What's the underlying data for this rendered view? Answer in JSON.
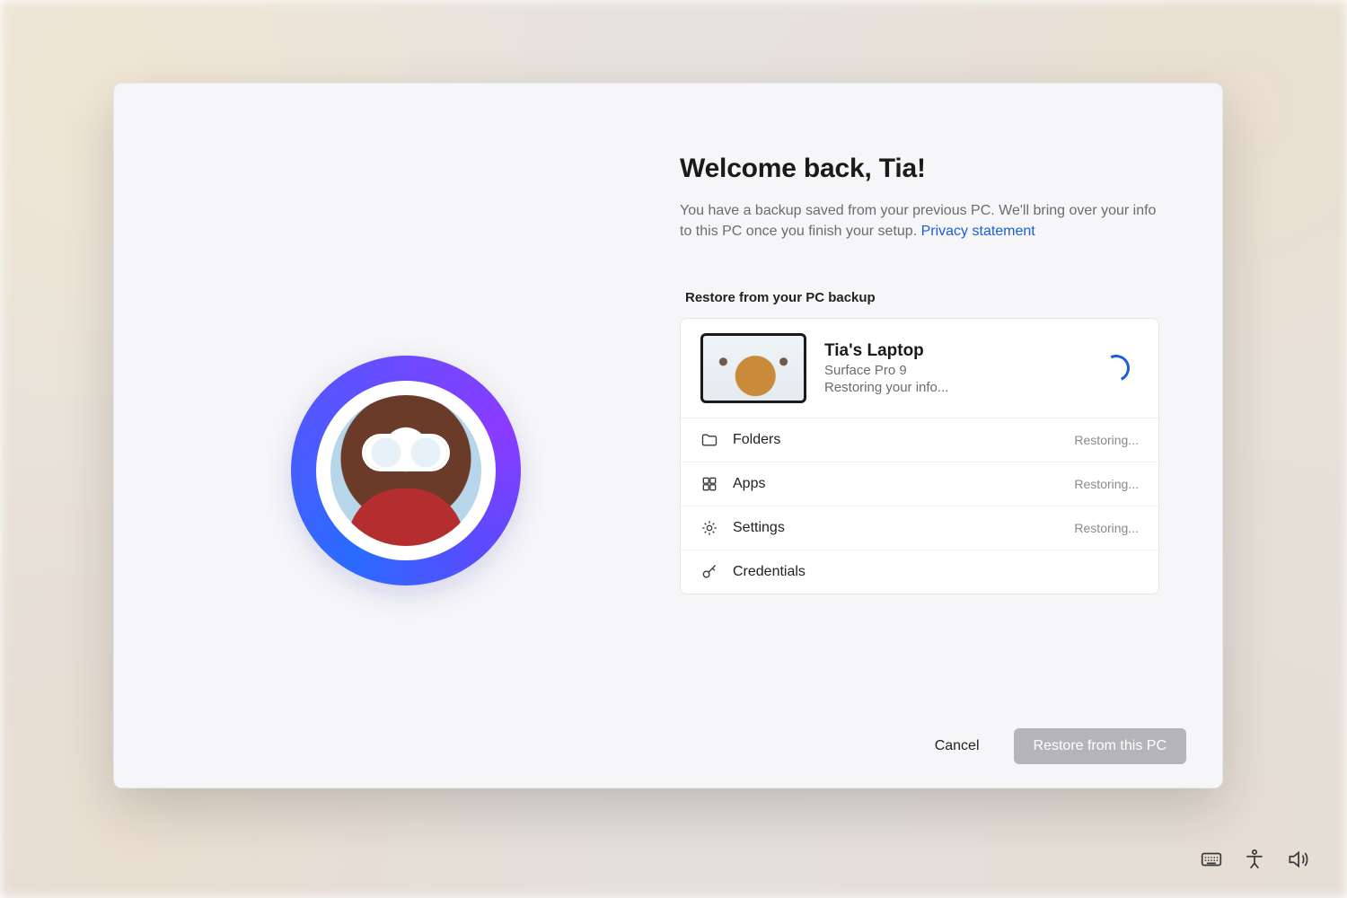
{
  "heading": "Welcome back, Tia!",
  "subtext_before": "You have a backup saved from your previous PC. We'll bring over your info to this PC once you finish your setup. ",
  "privacy_link": "Privacy statement",
  "section_label": "Restore from your PC backup",
  "device": {
    "name": "Tia's Laptop",
    "model": "Surface Pro 9",
    "status": "Restoring your info..."
  },
  "rows": [
    {
      "icon": "folder",
      "label": "Folders",
      "status": "Restoring..."
    },
    {
      "icon": "apps",
      "label": "Apps",
      "status": "Restoring..."
    },
    {
      "icon": "settings",
      "label": "Settings",
      "status": "Restoring..."
    },
    {
      "icon": "key",
      "label": "Credentials",
      "status": ""
    }
  ],
  "footer": {
    "cancel": "Cancel",
    "restore": "Restore from this PC"
  }
}
